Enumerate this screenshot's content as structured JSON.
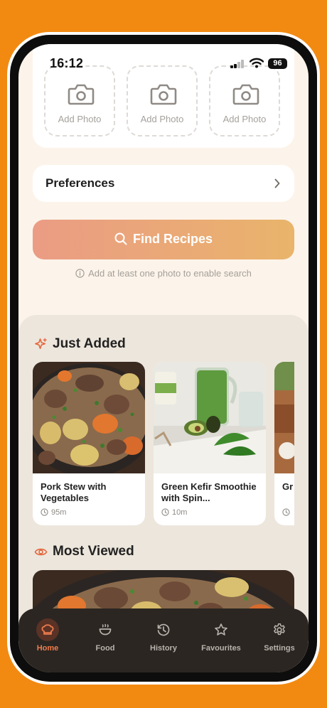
{
  "status": {
    "time": "16:12",
    "battery": "96"
  },
  "photos": {
    "slots": [
      "Add Photo",
      "Add Photo",
      "Add Photo"
    ]
  },
  "preferences": {
    "label": "Preferences"
  },
  "find": {
    "label": "Find Recipes",
    "hint": "Add at least one photo to enable search"
  },
  "just_added": {
    "title": "Just Added",
    "items": [
      {
        "title": "Pork Stew with Vegetables",
        "time": "95m"
      },
      {
        "title": "Green Kefir Smoothie with Spin...",
        "time": "10m"
      },
      {
        "title": "Gr",
        "time": ""
      }
    ]
  },
  "most_viewed": {
    "title": "Most Viewed"
  },
  "tabs": [
    {
      "label": "Home",
      "icon": "chef-hat-icon",
      "active": true
    },
    {
      "label": "Food",
      "icon": "bowl-icon",
      "active": false
    },
    {
      "label": "History",
      "icon": "history-icon",
      "active": false
    },
    {
      "label": "Favourites",
      "icon": "star-icon",
      "active": false
    },
    {
      "label": "Settings",
      "icon": "gear-icon",
      "active": false
    }
  ],
  "colors": {
    "accent": "#ef7d4e",
    "background": "#f28a12",
    "tabbar": "#2b2622"
  }
}
